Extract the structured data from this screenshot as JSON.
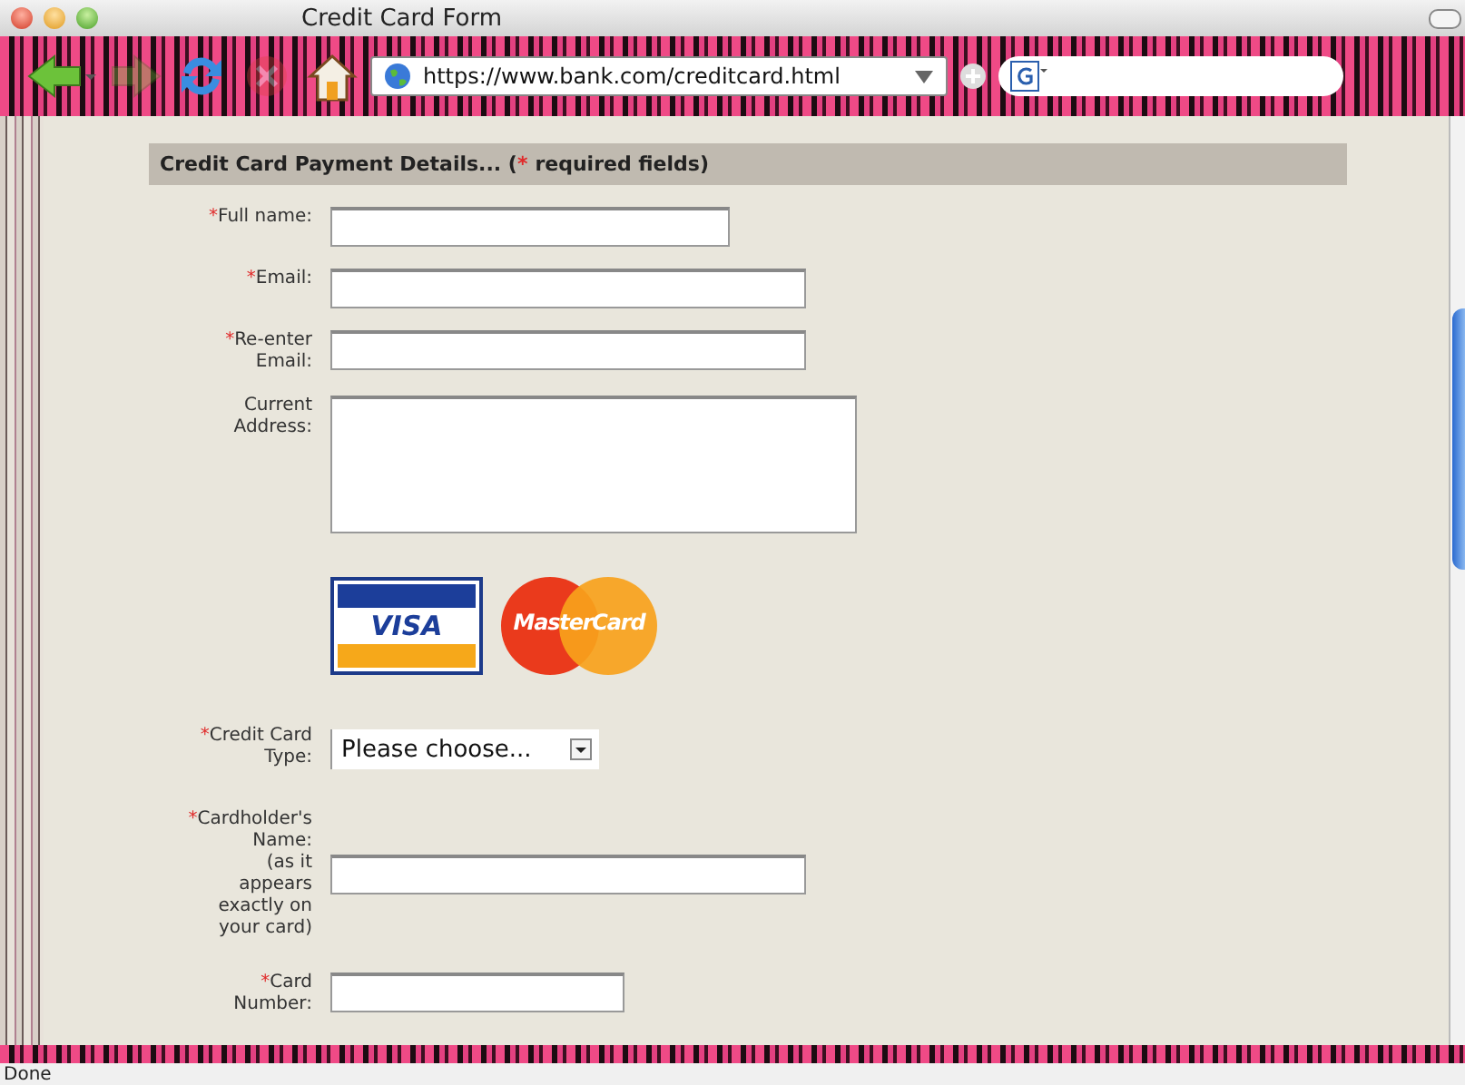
{
  "window": {
    "title": "Credit Card Form"
  },
  "toolbar": {
    "url": "https://www.bank.com/creditcard.html",
    "back_disabled": false,
    "forward_disabled": true,
    "stop_disabled": true
  },
  "form": {
    "heading": "Credit Card Payment Details... (",
    "heading_mark": "*",
    "heading_note": "required fields)",
    "rows": [
      {
        "kind": "text",
        "mark": "*",
        "label": "Full name:"
      },
      {
        "kind": "text",
        "mark": "*",
        "label": "Email:"
      },
      {
        "kind": "text",
        "mark": "*",
        "label": "Re-enter Email:"
      },
      {
        "kind": "textarea",
        "label": "Current Address:"
      },
      {
        "kind": "logos",
        "logos": [
          {
            "kind": "visa",
            "label": "VISA"
          },
          {
            "kind": "mastercard",
            "label": "MasterCard"
          }
        ]
      },
      {
        "kind": "select",
        "mark": "*",
        "label": "Credit Card Type:",
        "value": "Please choose..."
      },
      {
        "kind": "text",
        "mark": "*",
        "label": "Cardholder's Name:",
        "note": "(as it appears exactly on your card)"
      },
      {
        "kind": "text",
        "mark": "*",
        "label": "Card Number:"
      }
    ]
  },
  "status_bar": {
    "text": "Done"
  }
}
